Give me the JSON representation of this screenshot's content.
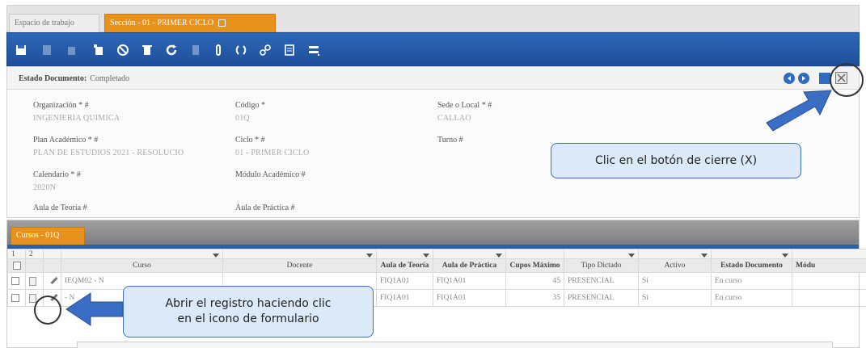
{
  "tabs": {
    "workspace": "Espacio de trabajo",
    "section": "Sección - 01 - PRIMER CICLO"
  },
  "toolbar": {
    "icons": [
      "save-icon",
      "new-icon",
      "copy-icon",
      "cancel-icon",
      "delete-icon",
      "refresh-icon",
      "find-icon",
      "attachment-icon",
      "history-icon",
      "link-icon",
      "report-icon",
      "menu-icon"
    ]
  },
  "status": {
    "label": "Estado Documento:",
    "value": "Completado"
  },
  "fields": {
    "organizacion": {
      "label": "Organización * #",
      "value": "INGENIERIA QUIMICA"
    },
    "codigo": {
      "label": "Código *",
      "value": "01Q"
    },
    "sede": {
      "label": "Sede o Local * #",
      "value": "CALLAO"
    },
    "plan": {
      "label": "Plan Académico * #",
      "value": "PLAN DE ESTUDIOS 2021 - RESOLUCIO"
    },
    "ciclo": {
      "label": "Ciclo * #",
      "value": "01 - PRIMER CICLO"
    },
    "turno": {
      "label": "Turno #",
      "value": ""
    },
    "calendario": {
      "label": "Calendario * #",
      "value": "2020N"
    },
    "modulo": {
      "label": "Módulo Académico #",
      "value": ""
    },
    "aula_teoria": {
      "label": "Aula de Teoría #",
      "value": ""
    },
    "aula_practica": {
      "label": "Aula de Práctica #",
      "value": ""
    }
  },
  "grid": {
    "tab": "Cursos - 01Q",
    "filter_cells": [
      "1",
      "2"
    ],
    "headers": [
      "Curso",
      "Docente",
      "Aula de Teoría",
      "Aula de Práctica",
      "Cupos Máximo",
      "Tipo Dictado",
      "Activo",
      "Estado Documento",
      "Módu"
    ],
    "rows": [
      {
        "curso": "IEQM02 - N",
        "docente": "",
        "aula_teoria": "FIQ1A01",
        "aula_practica": "FIQ1A01",
        "cupos": "45",
        "tipo": "PRESENCIAL",
        "activo": "Sí",
        "estado": "En curso",
        "modulo": ""
      },
      {
        "curso": "- N",
        "docente": "",
        "aula_teoria": "FIQ1A01",
        "aula_practica": "FIQ1A01",
        "cupos": "35",
        "tipo": "PRESENCIAL",
        "activo": "Sí",
        "estado": "En curso",
        "modulo": ""
      }
    ]
  },
  "annotations": {
    "close_hint": "Clic en el botón de cierre (X)",
    "open_hint_line1": "Abrir el registro haciendo clic",
    "open_hint_line2": "en el icono de formulario"
  },
  "colors": {
    "toolbar_blue": "#2a5fae",
    "active_tab_orange": "#e8921e",
    "callout_fill": "#dce9f8",
    "callout_border": "#3c6ec2",
    "arrow_blue": "#3a6ec4"
  }
}
